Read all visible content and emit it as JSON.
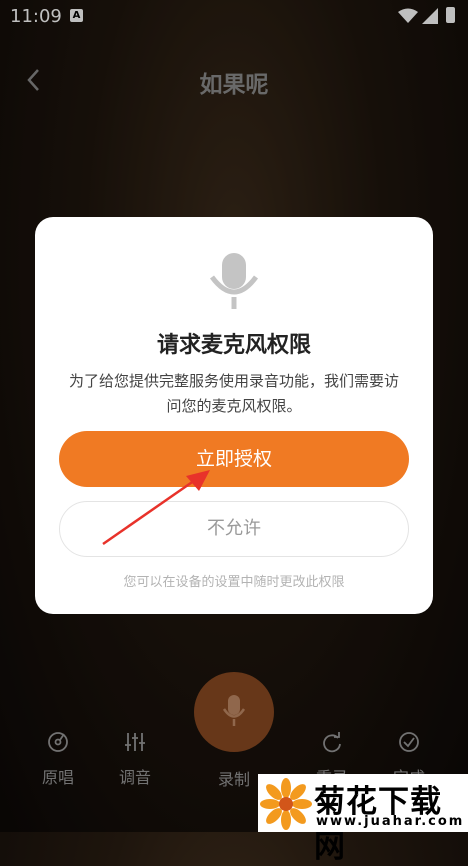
{
  "status_bar": {
    "time": "11:09",
    "notification_icon": "A"
  },
  "header": {
    "title": "如果呢"
  },
  "dialog": {
    "title": "请求麦克风权限",
    "description": "为了给您提供完整服务使用录音功能，我们需要访问您的麦克风权限。",
    "allow_label": "立即授权",
    "deny_label": "不允许",
    "note": "您可以在设备的设置中随时更改此权限"
  },
  "toolbar": {
    "items": [
      {
        "label": "原唱",
        "icon": "disc-icon"
      },
      {
        "label": "调音",
        "icon": "equalizer-icon"
      },
      {
        "label": "录制",
        "icon": "mic-icon"
      },
      {
        "label": "重录",
        "icon": "redo-icon"
      },
      {
        "label": "完成",
        "icon": "check-icon"
      }
    ]
  },
  "watermark": {
    "name": "菊花下载网",
    "url": "www.juahar.com"
  },
  "colors": {
    "accent": "#f07a23",
    "arrow": "#e8322a"
  }
}
